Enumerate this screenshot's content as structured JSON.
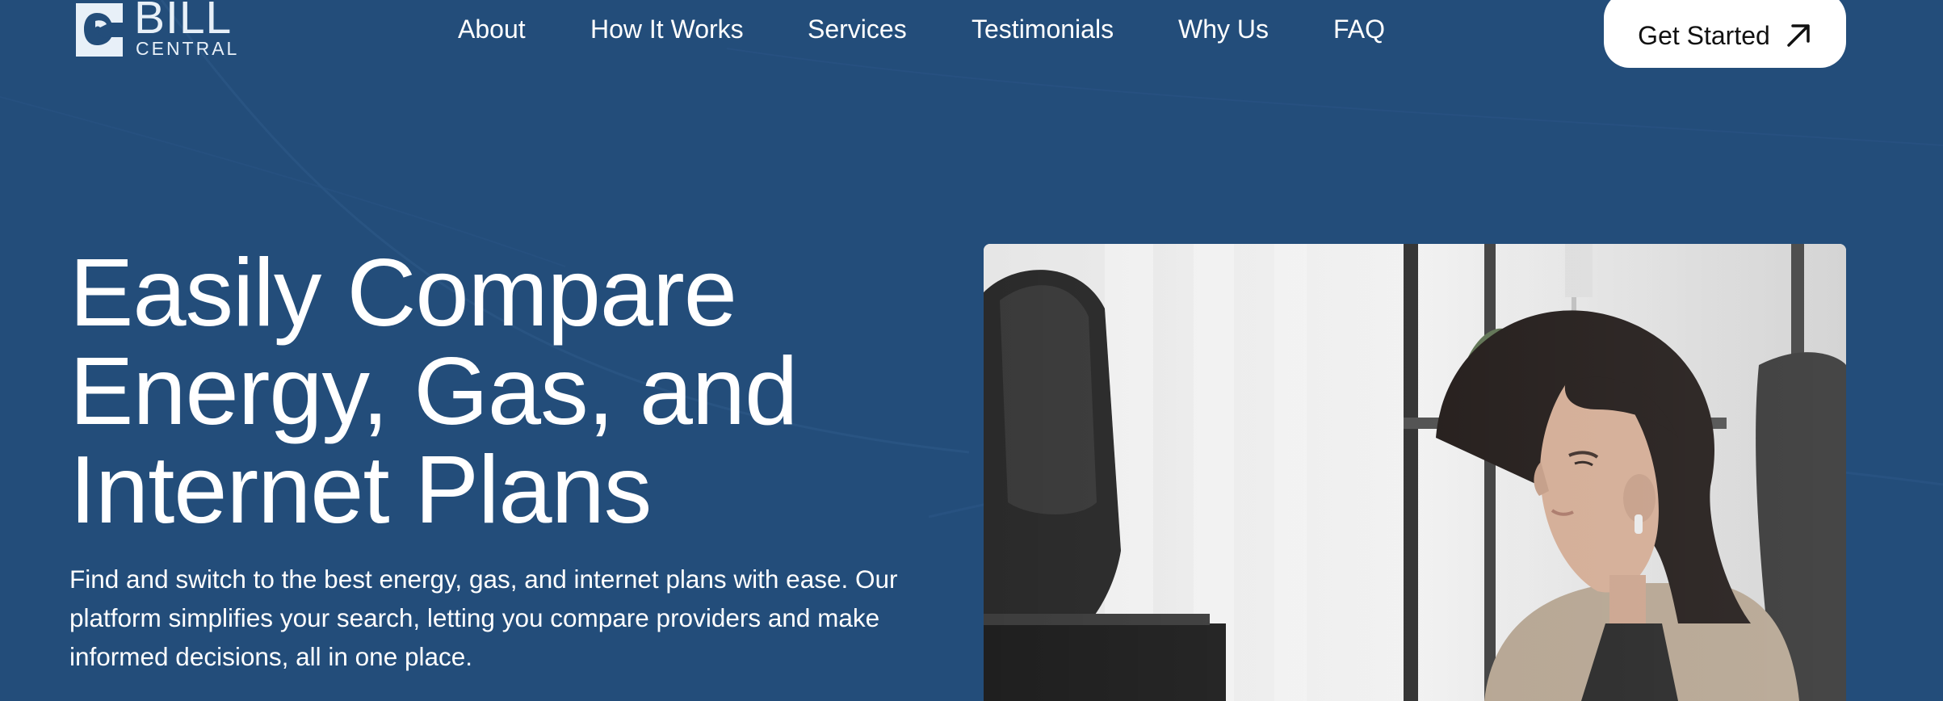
{
  "brand": {
    "logo_line1": "BILL",
    "logo_line2": "CENTRAL"
  },
  "nav": {
    "items": [
      {
        "label": "About"
      },
      {
        "label": "How It Works"
      },
      {
        "label": "Services"
      },
      {
        "label": "Testimonials"
      },
      {
        "label": "Why Us"
      },
      {
        "label": "FAQ"
      }
    ],
    "cta_label": "Get Started",
    "cta_icon": "arrow-up-right-icon"
  },
  "hero": {
    "title_line1": "Easily Compare",
    "title_line2": "Energy, Gas, and",
    "title_line3": "Internet Plans",
    "description": "Find and switch to the best energy, gas, and internet plans with ease. Our platform simplifies your search, letting you compare providers and make informed decisions, all in one place.",
    "image_subject": "woman working at a computer in an office"
  },
  "colors": {
    "background": "#234d7a",
    "text": "#ffffff",
    "cta_background": "#ffffff",
    "cta_text": "#111111"
  }
}
